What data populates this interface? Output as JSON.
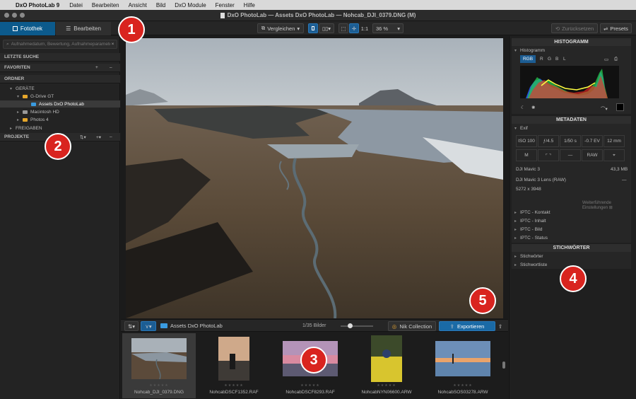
{
  "menubar": {
    "app_name": "DxO PhotoLab 9",
    "items": [
      "Datei",
      "Bearbeiten",
      "Ansicht",
      "Bild",
      "DxO Module",
      "Fenster",
      "Hilfe"
    ]
  },
  "window": {
    "title": "DxO PhotoLab — Assets DxO PhotoLab — Nohcab_DJI_0379.DNG (M)"
  },
  "toolbar": {
    "tab_library": "Fotothek",
    "tab_edit": "Bearbeiten",
    "compare_label": "Vergleichen",
    "zoom_1to1": "1:1",
    "zoom_value": "36 %",
    "reset_label": "Zurücksetzen",
    "presets_label": "Presets"
  },
  "left_panel": {
    "search_placeholder": "Aufnahmedatum, Bewertung, Aufnahmeparameter...",
    "sections": {
      "recent_search": "LETZTE SUCHE",
      "favorites": "FAVORITEN",
      "folders": "ORDNER",
      "projects": "PROJEKTE"
    },
    "tree": {
      "devices": "GERÄTE",
      "gdrive": "G-Drive GT",
      "assets": "Assets DxO PhotoLab",
      "macintosh": "Macintosh HD",
      "photos": "Photos 4",
      "shares": "FREIGABEN"
    }
  },
  "filmstrip_bar": {
    "folder": "Assets DxO PhotoLab",
    "count": "1/35 Bilder",
    "nik": "Nik Collection",
    "export": "Exportieren"
  },
  "filmstrip": [
    {
      "name": "Nohcab_DJI_0379.DNG",
      "selected": true
    },
    {
      "name": "NohcabDSCF1352.RAF",
      "selected": false
    },
    {
      "name": "NohcabDSCF8293.RAF",
      "selected": false
    },
    {
      "name": "NohcabNYN06600.ARW",
      "selected": false
    },
    {
      "name": "NohcabSOS03278.ARW",
      "selected": false
    }
  ],
  "right_panel": {
    "histogram": {
      "header": "HISTOGRAMM",
      "sub": "Histogramm",
      "channels": [
        "RGB",
        "R",
        "G",
        "B",
        "L"
      ]
    },
    "metadata": {
      "header": "METADATEN",
      "exif_label": "Exif",
      "iso": "ISO 100",
      "aperture": "ƒ/4.5",
      "shutter": "1/50 s",
      "ev": "-0.7 EV",
      "focal": "12 mm",
      "metering": "M",
      "flash": "—",
      "format": "RAW",
      "camera": "DJI Mavic 3",
      "size": "43,3 MB",
      "lens": "DJI Mavic 3 Lens (RAW)",
      "lens_extra": "—",
      "dims": "5272 x 3948",
      "more": "Weiterführende Einstellungen",
      "iptc": [
        "IPTC - Kontakt",
        "IPTC - Inhalt",
        "IPTC - Bild",
        "IPTC - Status"
      ]
    },
    "keywords": {
      "header": "STICHWÖRTER",
      "items": [
        "Stichwörter",
        "Stichwortliste"
      ]
    }
  },
  "badges": [
    "1",
    "2",
    "3",
    "4",
    "5"
  ]
}
